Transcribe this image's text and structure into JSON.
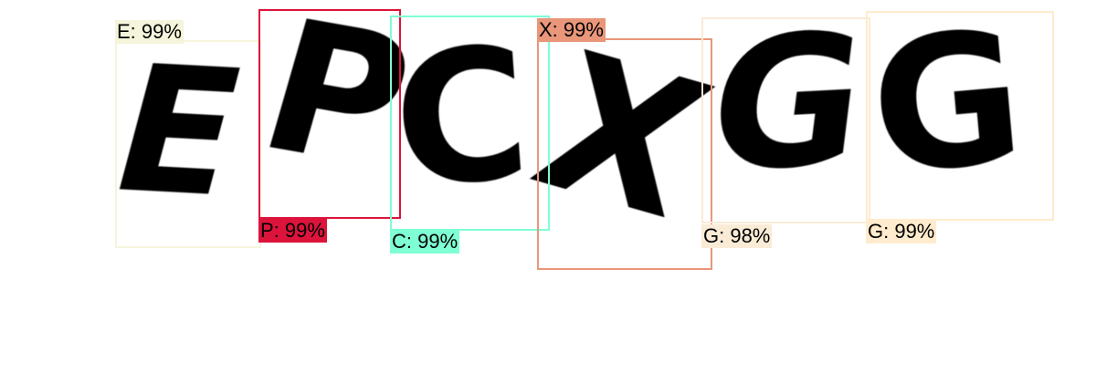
{
  "detections": [
    {
      "char": "E",
      "label": "E: 99%",
      "color": "#F5F5DC"
    },
    {
      "char": "P",
      "label": "P: 99%",
      "color": "#DC143C"
    },
    {
      "char": "C",
      "label": "C: 99%",
      "color": "#7FFFD4"
    },
    {
      "char": "X",
      "label": "X: 99%",
      "color": "#E9967A"
    },
    {
      "char": "G",
      "label": "G: 98%",
      "color": "#FAEBD7"
    },
    {
      "char": "G",
      "label": "G: 99%",
      "color": "#FFEBCD"
    }
  ]
}
